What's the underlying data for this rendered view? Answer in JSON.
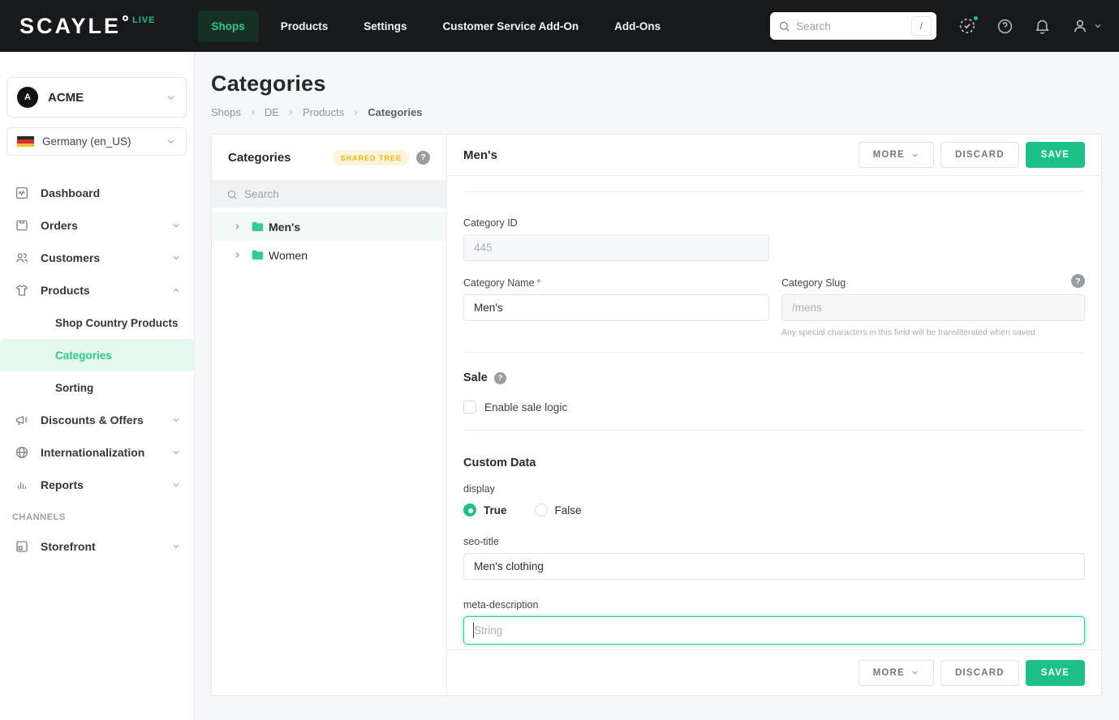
{
  "colors": {
    "brand_green": "#1ec185",
    "topbar_bg": "#17191d",
    "badge_amber_text": "#ecb613",
    "badge_amber_bg": "#fcf5db",
    "sidebar_active_bg": "#e4f8ee",
    "tree_selected_bg": "#f1faf6",
    "page_bg": "#f6f7f9",
    "focus_green": "#2bd093"
  },
  "topbar": {
    "logo": "SCAYLE",
    "env_badge": "LIVE",
    "nav": [
      {
        "label": "Shops",
        "active": true
      },
      {
        "label": "Products",
        "active": false
      },
      {
        "label": "Settings",
        "active": false
      },
      {
        "label": "Customer Service Add-On",
        "active": false
      },
      {
        "label": "Add-Ons",
        "active": false
      }
    ],
    "search": {
      "placeholder": "Search",
      "shortcut": "/"
    },
    "icons": [
      "status-check-icon",
      "help-icon",
      "bell-icon",
      "account-icon"
    ]
  },
  "sidebar": {
    "tenant": {
      "initial": "A",
      "name": "ACME"
    },
    "locale": {
      "label": "Germany (en_US)",
      "flag": "germany-flag-icon"
    },
    "items": [
      {
        "label": "Dashboard",
        "icon": "dashboard-icon"
      },
      {
        "label": "Orders",
        "icon": "orders-icon",
        "chevron": "down"
      },
      {
        "label": "Customers",
        "icon": "customers-icon",
        "chevron": "down"
      },
      {
        "label": "Products",
        "icon": "products-icon",
        "chevron": "up",
        "expanded": true
      },
      {
        "label": "Discounts & Offers",
        "icon": "megaphone-icon",
        "chevron": "down"
      },
      {
        "label": "Internationalization",
        "icon": "globe-icon",
        "chevron": "down"
      },
      {
        "label": "Reports",
        "icon": "bar-chart-icon",
        "chevron": "down"
      }
    ],
    "products_children": [
      {
        "label": "Shop Country Products",
        "active": false
      },
      {
        "label": "Categories",
        "active": true
      },
      {
        "label": "Sorting",
        "active": false
      }
    ],
    "section_label": "CHANNELS",
    "channels": [
      {
        "label": "Storefront",
        "icon": "storefront-icon",
        "chevron": "down"
      }
    ]
  },
  "page": {
    "title": "Categories",
    "breadcrumb": [
      "Shops",
      "DE",
      "Products",
      "Categories"
    ]
  },
  "tree_panel": {
    "title": "Categories",
    "badge": "SHARED TREE",
    "search_placeholder": "Search",
    "items": [
      {
        "label": "Men's",
        "selected": true,
        "icon": "folder-icon"
      },
      {
        "label": "Women",
        "selected": false,
        "icon": "folder-icon"
      }
    ]
  },
  "detail": {
    "title": "Men's",
    "actions": {
      "more": "MORE",
      "discard": "DISCARD",
      "save": "SAVE"
    },
    "fields": {
      "category_id": {
        "label": "Category ID",
        "value": "445",
        "disabled": true
      },
      "category_name": {
        "label": "Category Name",
        "value": "Men's",
        "required": true
      },
      "category_slug": {
        "label": "Category Slug",
        "value": "/mens",
        "disabled": true,
        "help": "Any special characters in this field will be transliterated when saved"
      }
    },
    "sale": {
      "heading": "Sale",
      "checkbox_label": "Enable sale logic",
      "checked": false
    },
    "custom_data": {
      "heading": "Custom Data",
      "display": {
        "label": "display",
        "options": [
          "True",
          "False"
        ],
        "selected": "True"
      },
      "seo_title": {
        "label": "seo-title",
        "value": "Men's clothing"
      },
      "meta_description": {
        "label": "meta-description",
        "placeholder": "String",
        "focused": true
      }
    }
  }
}
